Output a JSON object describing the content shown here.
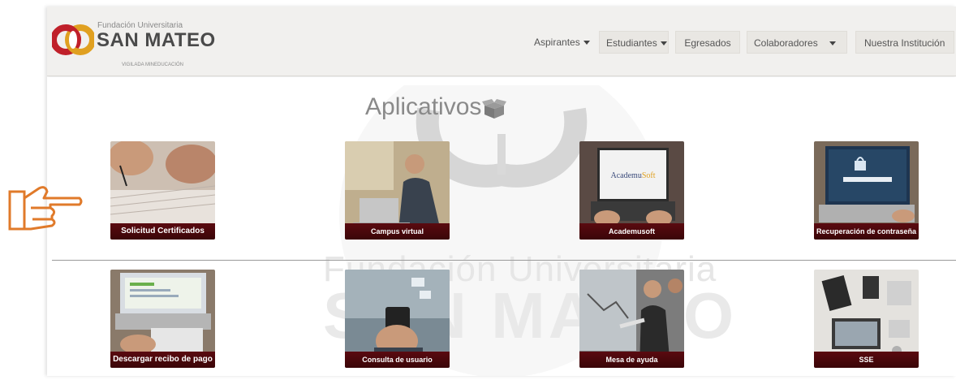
{
  "colors": {
    "accent": "#5a0a10",
    "pointer": "#e07a2a",
    "logo_red": "#c0202a",
    "logo_gold": "#e0a020"
  },
  "header": {
    "logo": {
      "top_line": "Fundación Universitaria",
      "name": "SAN MATEO",
      "sub_line": "VIGILADA MINEDUCACIÓN"
    },
    "nav": [
      {
        "label": "Aspirantes",
        "has_caret": true
      },
      {
        "label": "Estudiantes",
        "has_caret": true
      },
      {
        "label": "Egresados",
        "has_caret": false
      },
      {
        "label": "Colaboradores",
        "has_caret": true
      },
      {
        "label": "Nuestra Institución",
        "has_caret": false
      }
    ]
  },
  "main": {
    "title": "Aplicativos",
    "title_icon": "open-box-icon",
    "watermark_line1": "Fundación Universitaria",
    "watermark_line2": "SAN MATEO",
    "pointer_icon": "hand-pointing-right-icon",
    "tiles": [
      {
        "label": "Solicitud Certificados",
        "icon": "hands-writing-image"
      },
      {
        "label": "Campus virtual",
        "icon": "student-laptop-image"
      },
      {
        "label": "Academusoft",
        "icon": "academusoft-laptop-image",
        "screen_text": "AcademuSoft"
      },
      {
        "label": "Recuperación de contraseña",
        "icon": "password-laptop-image"
      },
      {
        "label": "Descargar recibo de pago",
        "icon": "calculator-laptop-image"
      },
      {
        "label": "Consulta de usuario",
        "icon": "phone-messages-image"
      },
      {
        "label": "Mesa de ayuda",
        "icon": "meeting-screen-image"
      },
      {
        "label": "SSE",
        "icon": "desk-devices-image"
      }
    ]
  }
}
